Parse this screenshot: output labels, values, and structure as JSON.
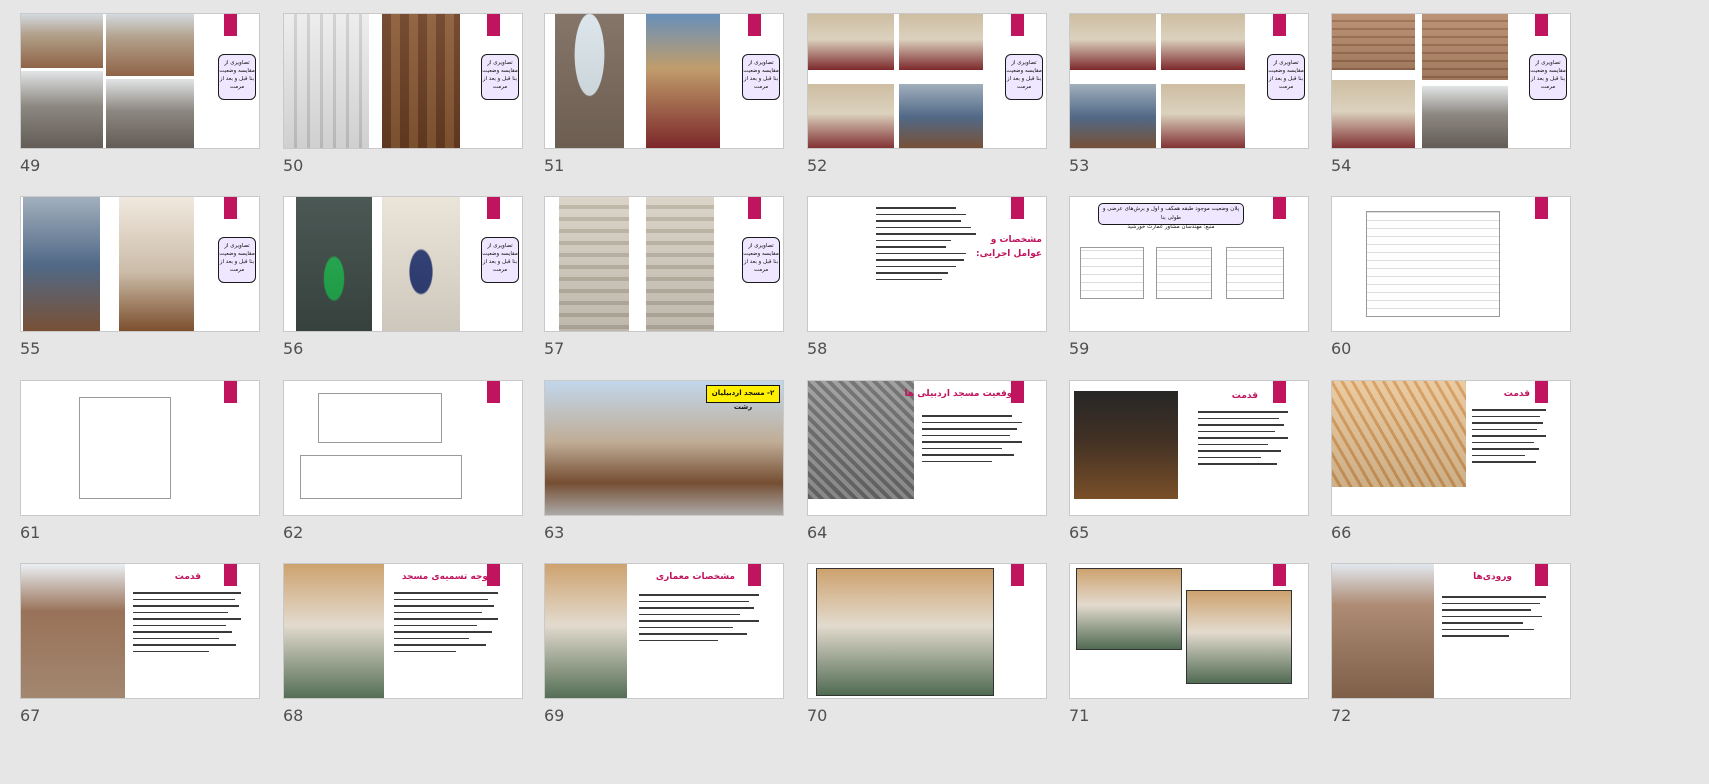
{
  "slides": [
    {
      "num": "49",
      "label": "تصاویری از\nمقایسه وضعیت\nبنا قبل و بعد از\nمرمت"
    },
    {
      "num": "50",
      "label": "تصاویری از\nمقایسه وضعیت\nبنا قبل و بعد از\nمرمت"
    },
    {
      "num": "51",
      "label": "تصاویری از\nمقایسه وضعیت\nبنا قبل و بعد از\nمرمت"
    },
    {
      "num": "52",
      "label": "تصاویری از\nمقایسه وضعیت\nبنا قبل و بعد از\nمرمت"
    },
    {
      "num": "53",
      "label": "تصاویری از\nمقایسه وضعیت\nبنا قبل و بعد از\nمرمت"
    },
    {
      "num": "54",
      "label": "تصاویری از\nمقایسه وضعیت\nبنا قبل و بعد از\nمرمت"
    },
    {
      "num": "55",
      "label": "تصاویری از\nمقایسه وضعیت\nبنا قبل و بعد از\nمرمت"
    },
    {
      "num": "56",
      "label": "تصاویری از\nمقایسه وضعیت\nبنا قبل و بعد از\nمرمت"
    },
    {
      "num": "57",
      "label": "تصاویری از\nمقایسه وضعیت\nبنا قبل و بعد از\nمرمت"
    },
    {
      "num": "58",
      "title": "مشخصات و\nعوامل اجرایی:"
    },
    {
      "num": "59",
      "title": "پلان وضعیت موجود طبقه همکف و اول و برش‌های عرضی و طولی بنا\nمنبع: مهندسان مشاور عمارت خورشید"
    },
    {
      "num": "60"
    },
    {
      "num": "61"
    },
    {
      "num": "62"
    },
    {
      "num": "63",
      "title": "۲- مسجد اردبیلیان رشت"
    },
    {
      "num": "64",
      "title": "موقعیت مسجد اردبیلی ها"
    },
    {
      "num": "65",
      "title": "قدمت"
    },
    {
      "num": "66",
      "title": "قدمت"
    },
    {
      "num": "67",
      "title": "قدمت"
    },
    {
      "num": "68",
      "title": "وجه تسمیه‌ی مسجد"
    },
    {
      "num": "69",
      "title": "مشخصات معماری"
    },
    {
      "num": "70"
    },
    {
      "num": "71"
    },
    {
      "num": "72",
      "title": "ورودی‌ها"
    }
  ],
  "colors": {
    "accent": "#c0145e",
    "background": "#e6e6e6",
    "label_box": "#efe6ff",
    "yellow": "#ffef00"
  }
}
